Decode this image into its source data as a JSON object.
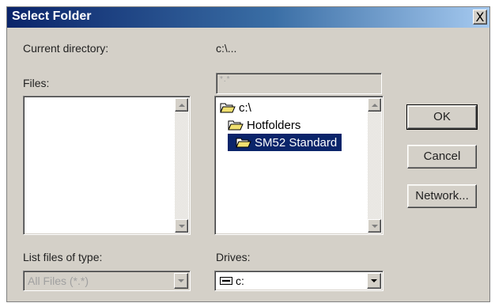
{
  "window": {
    "title": "Select Folder",
    "close_glyph": "X",
    "close_icon": "close-icon"
  },
  "labels": {
    "current_directory": "Current directory:",
    "current_directory_value": "c:\\...",
    "files": "Files:",
    "list_files_of_type": "List files of type:",
    "drives": "Drives:"
  },
  "filename_input": {
    "value": "*.*"
  },
  "files_list": {
    "items": []
  },
  "directories": [
    {
      "label": "c:\\",
      "icon": "open-folder-icon",
      "selected": false
    },
    {
      "label": "Hotfolders",
      "icon": "open-folder-icon",
      "selected": false
    },
    {
      "label": "SM52 Standard",
      "icon": "open-folder-icon",
      "selected": true
    }
  ],
  "buttons": {
    "ok": "OK",
    "cancel": "Cancel",
    "network": "Network..."
  },
  "file_type": {
    "selected": "All Files (*.*)"
  },
  "drive": {
    "selected": "c:",
    "icon": "drive-icon"
  },
  "colors": {
    "title_bar_start": "#0a246a",
    "title_bar_end": "#a6caf0",
    "selection": "#0a246a",
    "dialog_face": "#d4d0c8"
  }
}
